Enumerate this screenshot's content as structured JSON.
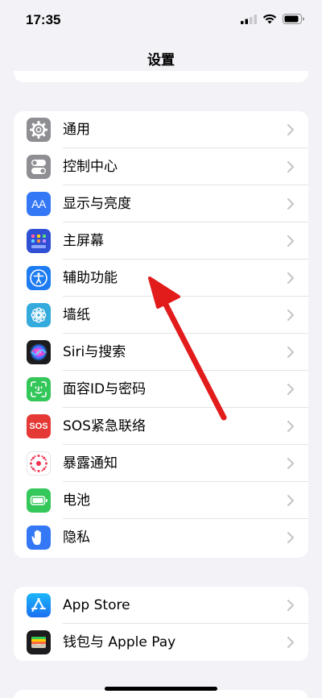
{
  "status_bar": {
    "time": "17:35",
    "icons": [
      "signal-icon",
      "wifi-icon",
      "battery-icon"
    ]
  },
  "nav": {
    "title": "设置"
  },
  "groups": [
    {
      "items": [
        {
          "label": "通用",
          "icon": "gear-icon",
          "color": "#8e8e93"
        },
        {
          "label": "控制中心",
          "icon": "toggles-icon",
          "color": "#8e8e93"
        },
        {
          "label": "显示与亮度",
          "icon": "aa-icon",
          "icon_text": "AA",
          "color": "#3478f6"
        },
        {
          "label": "主屏幕",
          "icon": "home-screen-grid-icon",
          "color": "#2f4fd4"
        },
        {
          "label": "辅助功能",
          "icon": "accessibility-icon",
          "color": "#1e7cf2"
        },
        {
          "label": "墙纸",
          "icon": "flower-icon",
          "color": "#35aadc"
        },
        {
          "label": "Siri与搜索",
          "icon": "siri-icon",
          "color": "#1c1c1e"
        },
        {
          "label": "面容ID与密码",
          "icon": "face-id-icon",
          "color": "#33c659"
        },
        {
          "label": "SOS紧急联络",
          "icon": "sos-icon",
          "icon_text": "SOS",
          "color": "#e53935"
        },
        {
          "label": "暴露通知",
          "icon": "exposure-icon",
          "color": "#ffffff"
        },
        {
          "label": "电池",
          "icon": "battery-icon",
          "color": "#34c759"
        },
        {
          "label": "隐私",
          "icon": "hand-icon",
          "color": "#3478f6"
        }
      ]
    },
    {
      "items": [
        {
          "label": "App Store",
          "icon": "app-store-icon",
          "color": "#1a8cf5"
        },
        {
          "label": "钱包与 Apple Pay",
          "icon": "wallet-icon",
          "color": "#1c1c1e"
        }
      ]
    }
  ],
  "accent_colors": {
    "arrow": "#e21b1b",
    "chevron": "#c4c4c7"
  }
}
